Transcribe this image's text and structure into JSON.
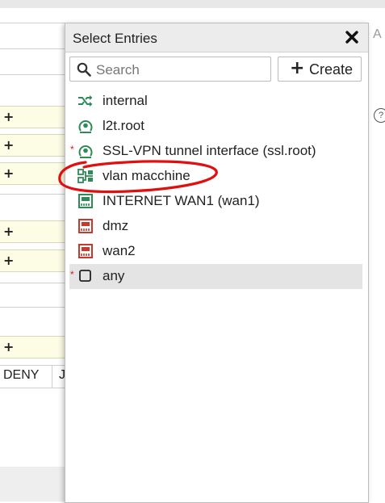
{
  "background": {
    "plus_symbol": "+",
    "deny_text": "DENY",
    "partial_text": "J",
    "right_letter": "A",
    "help_symbol": "?"
  },
  "dialog": {
    "title": "Select Entries",
    "close_icon": "close-icon",
    "search": {
      "placeholder": "Search",
      "value": ""
    },
    "create_button": {
      "icon": "+",
      "label": "Create"
    },
    "entries": [
      {
        "label": "internal",
        "icon": "shuffle-icon",
        "required": false,
        "selected": false
      },
      {
        "label": "l2t.root",
        "icon": "tunnel-icon",
        "required": false,
        "selected": false
      },
      {
        "label": "SSL-VPN tunnel interface (ssl.root)",
        "icon": "tunnel-icon",
        "required": true,
        "selected": false
      },
      {
        "label": "vlan macchine",
        "icon": "vlan-icon",
        "required": false,
        "selected": false
      },
      {
        "label": "INTERNET WAN1 (wan1)",
        "icon": "ethernet-port-icon",
        "required": false,
        "selected": false
      },
      {
        "label": "dmz",
        "icon": "ethernet-port-icon",
        "required": false,
        "selected": false
      },
      {
        "label": "wan2",
        "icon": "ethernet-port-icon",
        "required": false,
        "selected": false
      },
      {
        "label": "any",
        "icon": "square-icon",
        "required": true,
        "selected": true
      }
    ],
    "required_marker": "*",
    "colors": {
      "green_icon": "#2e8b57",
      "red_icon": "#c8382c",
      "annotation": "#e01010",
      "selected_bg": "#e4e4e4"
    }
  }
}
